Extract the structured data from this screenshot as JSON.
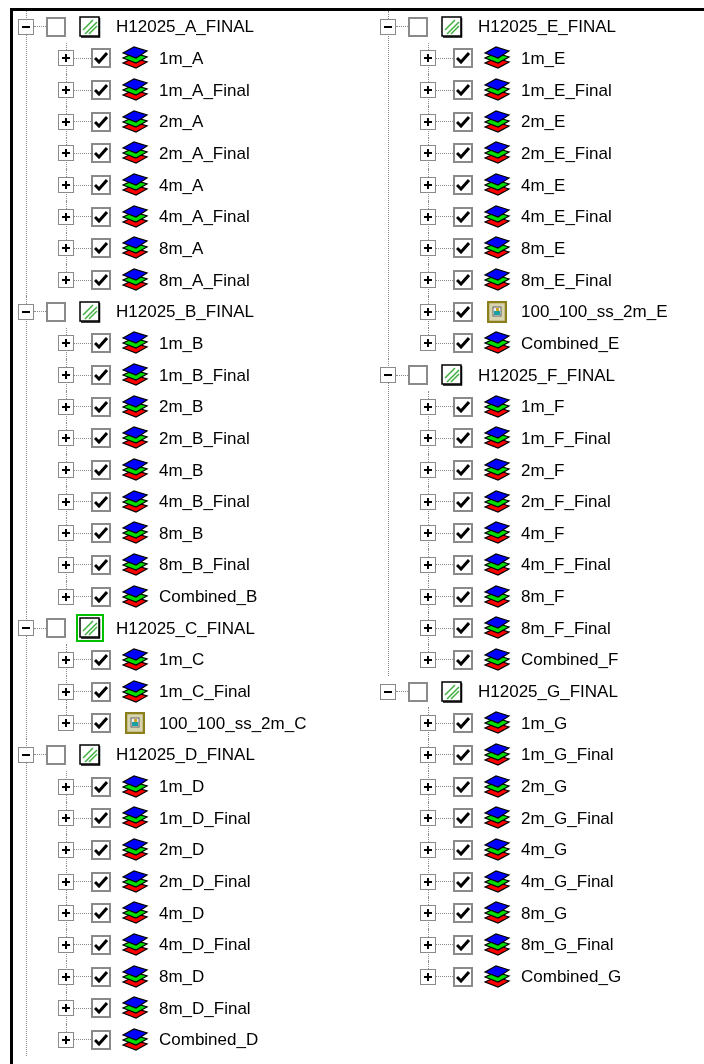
{
  "columns": [
    [
      {
        "label": "H12025_A_FINAL",
        "expanded": true,
        "checked": false,
        "selected": false,
        "children": [
          {
            "label": "1m_A",
            "kind": "layers",
            "expanded": false,
            "checked": true
          },
          {
            "label": "1m_A_Final",
            "kind": "layers",
            "expanded": false,
            "checked": true
          },
          {
            "label": "2m_A",
            "kind": "layers",
            "expanded": false,
            "checked": true
          },
          {
            "label": "2m_A_Final",
            "kind": "layers",
            "expanded": false,
            "checked": true
          },
          {
            "label": "4m_A",
            "kind": "layers",
            "expanded": false,
            "checked": true
          },
          {
            "label": "4m_A_Final",
            "kind": "layers",
            "expanded": false,
            "checked": true
          },
          {
            "label": "8m_A",
            "kind": "layers",
            "expanded": false,
            "checked": true
          },
          {
            "label": "8m_A_Final",
            "kind": "layers",
            "expanded": false,
            "checked": true
          }
        ]
      },
      {
        "label": "H12025_B_FINAL",
        "expanded": true,
        "checked": false,
        "selected": false,
        "children": [
          {
            "label": "1m_B",
            "kind": "layers",
            "expanded": false,
            "checked": true
          },
          {
            "label": "1m_B_Final",
            "kind": "layers",
            "expanded": false,
            "checked": true
          },
          {
            "label": "2m_B",
            "kind": "layers",
            "expanded": false,
            "checked": true
          },
          {
            "label": "2m_B_Final",
            "kind": "layers",
            "expanded": false,
            "checked": true
          },
          {
            "label": "4m_B",
            "kind": "layers",
            "expanded": false,
            "checked": true
          },
          {
            "label": "4m_B_Final",
            "kind": "layers",
            "expanded": false,
            "checked": true
          },
          {
            "label": "8m_B",
            "kind": "layers",
            "expanded": false,
            "checked": true
          },
          {
            "label": "8m_B_Final",
            "kind": "layers",
            "expanded": false,
            "checked": true
          },
          {
            "label": "Combined_B",
            "kind": "layers",
            "expanded": false,
            "checked": true
          }
        ]
      },
      {
        "label": "H12025_C_FINAL",
        "expanded": true,
        "checked": false,
        "selected": true,
        "children": [
          {
            "label": "1m_C",
            "kind": "layers",
            "expanded": false,
            "checked": true
          },
          {
            "label": "1m_C_Final",
            "kind": "layers",
            "expanded": false,
            "checked": true
          },
          {
            "label": "100_100_ss_2m_C",
            "kind": "image",
            "expanded": false,
            "checked": true
          }
        ]
      },
      {
        "label": "H12025_D_FINAL",
        "expanded": true,
        "checked": false,
        "selected": false,
        "children": [
          {
            "label": "1m_D",
            "kind": "layers",
            "expanded": false,
            "checked": true
          },
          {
            "label": "1m_D_Final",
            "kind": "layers",
            "expanded": false,
            "checked": true
          },
          {
            "label": "2m_D",
            "kind": "layers",
            "expanded": false,
            "checked": true
          },
          {
            "label": "2m_D_Final",
            "kind": "layers",
            "expanded": false,
            "checked": true
          },
          {
            "label": "4m_D",
            "kind": "layers",
            "expanded": false,
            "checked": true
          },
          {
            "label": "4m_D_Final",
            "kind": "layers",
            "expanded": false,
            "checked": true
          },
          {
            "label": "8m_D",
            "kind": "layers",
            "expanded": false,
            "checked": true
          },
          {
            "label": "8m_D_Final",
            "kind": "layers",
            "expanded": false,
            "checked": true
          },
          {
            "label": "Combined_D",
            "kind": "layers",
            "expanded": false,
            "checked": true
          }
        ]
      }
    ],
    [
      {
        "label": "H12025_E_FINAL",
        "expanded": true,
        "checked": false,
        "selected": false,
        "children": [
          {
            "label": "1m_E",
            "kind": "layers",
            "expanded": false,
            "checked": true
          },
          {
            "label": "1m_E_Final",
            "kind": "layers",
            "expanded": false,
            "checked": true
          },
          {
            "label": "2m_E",
            "kind": "layers",
            "expanded": false,
            "checked": true
          },
          {
            "label": "2m_E_Final",
            "kind": "layers",
            "expanded": false,
            "checked": true
          },
          {
            "label": "4m_E",
            "kind": "layers",
            "expanded": false,
            "checked": true
          },
          {
            "label": "4m_E_Final",
            "kind": "layers",
            "expanded": false,
            "checked": true
          },
          {
            "label": "8m_E",
            "kind": "layers",
            "expanded": false,
            "checked": true
          },
          {
            "label": "8m_E_Final",
            "kind": "layers",
            "expanded": false,
            "checked": true
          },
          {
            "label": "100_100_ss_2m_E",
            "kind": "image",
            "expanded": false,
            "checked": true
          },
          {
            "label": "Combined_E",
            "kind": "layers",
            "expanded": false,
            "checked": true
          }
        ]
      },
      {
        "label": "H12025_F_FINAL",
        "expanded": true,
        "checked": false,
        "selected": false,
        "children": [
          {
            "label": "1m_F",
            "kind": "layers",
            "expanded": false,
            "checked": true
          },
          {
            "label": "1m_F_Final",
            "kind": "layers",
            "expanded": false,
            "checked": true
          },
          {
            "label": "2m_F",
            "kind": "layers",
            "expanded": false,
            "checked": true
          },
          {
            "label": "2m_F_Final",
            "kind": "layers",
            "expanded": false,
            "checked": true
          },
          {
            "label": "4m_F",
            "kind": "layers",
            "expanded": false,
            "checked": true
          },
          {
            "label": "4m_F_Final",
            "kind": "layers",
            "expanded": false,
            "checked": true
          },
          {
            "label": "8m_F",
            "kind": "layers",
            "expanded": false,
            "checked": true
          },
          {
            "label": "8m_F_Final",
            "kind": "layers",
            "expanded": false,
            "checked": true
          },
          {
            "label": "Combined_F",
            "kind": "layers",
            "expanded": false,
            "checked": true
          }
        ]
      },
      {
        "label": "H12025_G_FINAL",
        "expanded": true,
        "checked": false,
        "selected": false,
        "children": [
          {
            "label": "1m_G",
            "kind": "layers",
            "expanded": false,
            "checked": true
          },
          {
            "label": "1m_G_Final",
            "kind": "layers",
            "expanded": false,
            "checked": true
          },
          {
            "label": "2m_G",
            "kind": "layers",
            "expanded": false,
            "checked": true
          },
          {
            "label": "2m_G_Final",
            "kind": "layers",
            "expanded": false,
            "checked": true
          },
          {
            "label": "4m_G",
            "kind": "layers",
            "expanded": false,
            "checked": true
          },
          {
            "label": "4m_G_Final",
            "kind": "layers",
            "expanded": false,
            "checked": true
          },
          {
            "label": "8m_G",
            "kind": "layers",
            "expanded": false,
            "checked": true
          },
          {
            "label": "8m_G_Final",
            "kind": "layers",
            "expanded": false,
            "checked": true
          },
          {
            "label": "Combined_G",
            "kind": "layers",
            "expanded": false,
            "checked": true
          }
        ]
      }
    ]
  ]
}
